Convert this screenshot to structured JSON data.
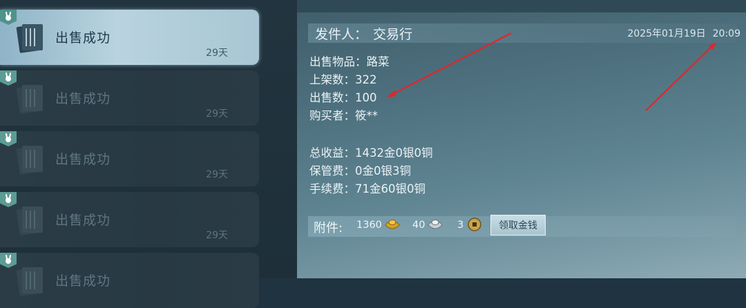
{
  "mail_list": {
    "items": [
      {
        "title": "出售成功",
        "days": "29天",
        "selected": true
      },
      {
        "title": "出售成功",
        "days": "29天",
        "selected": false
      },
      {
        "title": "出售成功",
        "days": "29天",
        "selected": false
      },
      {
        "title": "出售成功",
        "days": "29天",
        "selected": false
      },
      {
        "title": "出售成功",
        "days": "",
        "selected": false
      }
    ],
    "badge_icon": "rabbit-icon",
    "mail_icon": "scroll-icon"
  },
  "detail": {
    "sender_label": "发件人：",
    "sender": "交易行",
    "date": "2025年01月19日",
    "time": "20:09",
    "lines": [
      "出售物品：路菜",
      "上架数：322",
      "出售数：100",
      "购买者：筱**"
    ],
    "summary": [
      "总收益：1432金0银0铜",
      "保管费：0金0银3铜",
      "手续费：71金60银0铜"
    ]
  },
  "attachments": {
    "label": "附件:",
    "gold": "1360",
    "silver": "40",
    "copper": "3",
    "claim_button": "领取金钱",
    "icons": [
      "gold-ingot-icon",
      "silver-ingot-icon",
      "copper-coin-icon"
    ]
  },
  "colors": {
    "annotation_red": "#e0262a",
    "badge": "#5c9c95"
  }
}
